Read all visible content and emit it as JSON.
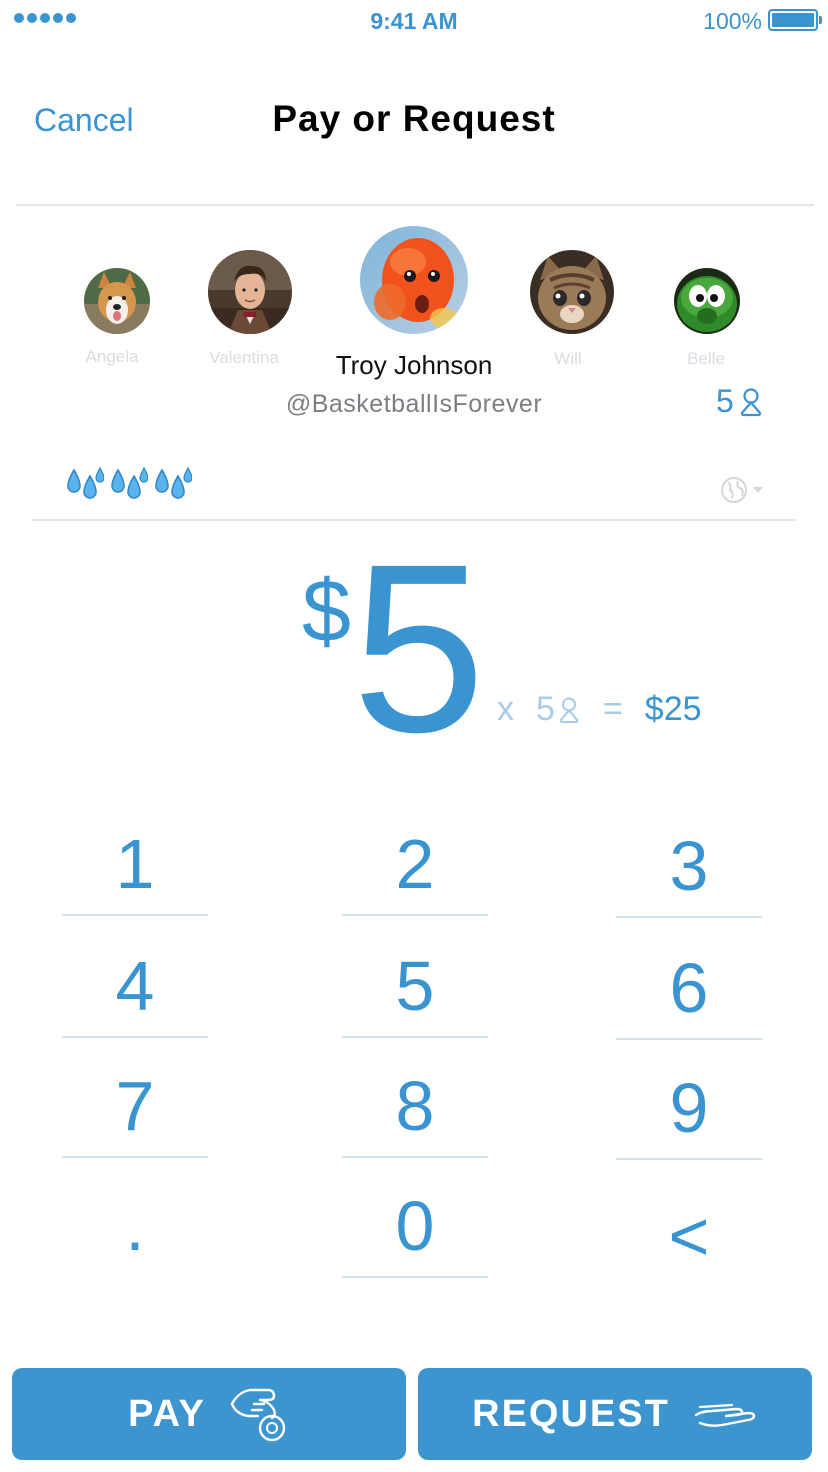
{
  "status_bar": {
    "time": "9:41 AM",
    "battery": "100%"
  },
  "header": {
    "cancel": "Cancel",
    "title": "Pay or Request"
  },
  "recipients": {
    "others": [
      {
        "name": "Angela",
        "avatar": "corgi-dog"
      },
      {
        "name": "Valentina",
        "avatar": "man-with-bowtie"
      },
      {
        "name": "Will",
        "avatar": "tabby-cat"
      },
      {
        "name": "Belle",
        "avatar": "green-cartoon-character"
      }
    ],
    "selected": {
      "name": "Troy Johnson",
      "handle": "@BasketballIsForever",
      "avatar": "goldfish"
    },
    "count": "5"
  },
  "note": {
    "emoji": [
      "sweat-droplets",
      "sweat-droplets",
      "sweat-droplets"
    ],
    "privacy_icon": "globe-icon"
  },
  "amount": {
    "currency": "$",
    "value": "5",
    "multiplier_prefix": "x",
    "multiplier": "5",
    "equals": "=",
    "total": "$25"
  },
  "keypad": {
    "keys": [
      "1",
      "2",
      "3",
      "4",
      "5",
      "6",
      "7",
      "8",
      "9",
      ".",
      "0",
      "<"
    ]
  },
  "actions": {
    "pay": "PAY",
    "request": "REQUEST"
  },
  "colors": {
    "accent": "#3a94d1",
    "button": "#3d95d0",
    "muted": "#a6cde8"
  }
}
